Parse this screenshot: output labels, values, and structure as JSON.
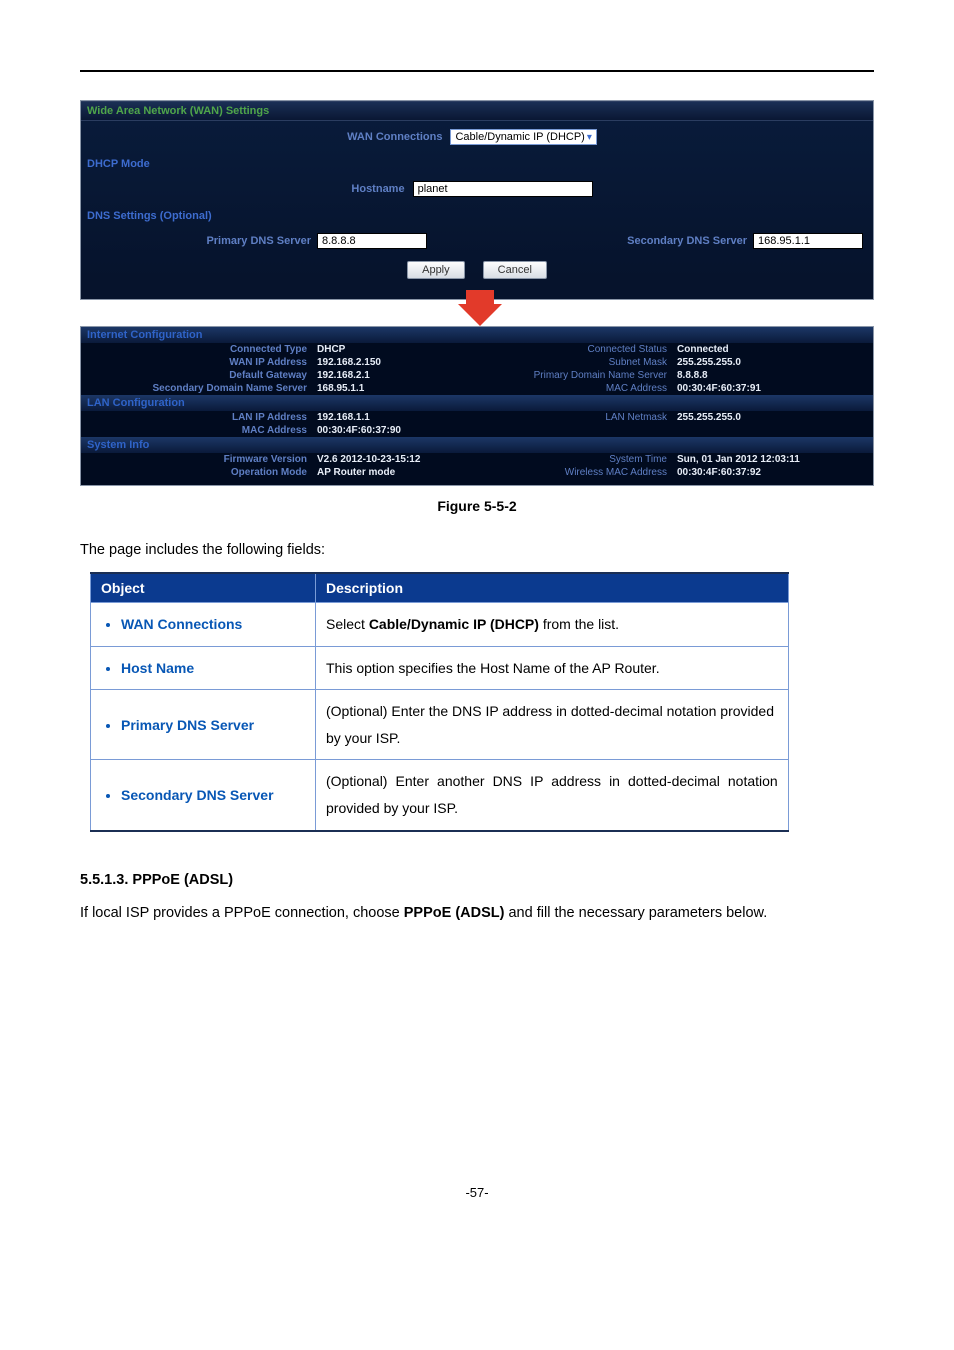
{
  "panel": {
    "wan_title": "Wide Area Network (WAN) Settings",
    "wan_conn_label": "WAN Connections",
    "wan_conn_value": "Cable/Dynamic IP (DHCP)",
    "dhcp_mode": "DHCP Mode",
    "hostname_label": "Hostname",
    "hostname_value": "planet",
    "dns_title": "DNS Settings (Optional)",
    "pdns_label": "Primary DNS Server",
    "pdns_value": "8.8.8.8",
    "sdns_label": "Secondary DNS Server",
    "sdns_value": "168.95.1.1",
    "apply": "Apply",
    "cancel": "Cancel"
  },
  "status": {
    "internet_hdr": "Internet Configuration",
    "rows": {
      "connected_type_l": "Connected Type",
      "connected_type_v": "DHCP",
      "connected_status_l": "Connected Status",
      "connected_status_v": "Connected",
      "wan_ip_l": "WAN IP Address",
      "wan_ip_v": "192.168.2.150",
      "subnet_l": "Subnet Mask",
      "subnet_v": "255.255.255.0",
      "gateway_l": "Default Gateway",
      "gateway_v": "192.168.2.1",
      "pdns_l": "Primary Domain Name Server",
      "pdns_v": "8.8.8.8",
      "sdns_l": "Secondary Domain Name Server",
      "sdns_v": "168.95.1.1",
      "mac_l": "MAC Address",
      "mac_v": "00:30:4F:60:37:91"
    },
    "lan_hdr": "LAN Configuration",
    "lan": {
      "ip_l": "LAN IP Address",
      "ip_v": "192.168.1.1",
      "nm_l": "LAN Netmask",
      "nm_v": "255.255.255.0",
      "mac_l": "MAC Address",
      "mac_v": "00:30:4F:60:37:90"
    },
    "sys_hdr": "System Info",
    "sys": {
      "fw_l": "Firmware Version",
      "fw_v": "V2.6 2012-10-23-15:12",
      "time_l": "System Time",
      "time_v": "Sun, 01 Jan 2012 12:03:11",
      "op_l": "Operation Mode",
      "op_v": "AP Router mode",
      "wmac_l": "Wireless MAC Address",
      "wmac_v": "00:30:4F:60:37:92"
    }
  },
  "figure_caption": "Figure 5-5-2",
  "intro": "The page includes the following fields:",
  "table": {
    "h1": "Object",
    "h2": "Description",
    "r1o": "WAN Connections",
    "r1d_pre": "Select ",
    "r1d_b": "Cable/Dynamic IP (DHCP)",
    "r1d_post": " from the list.",
    "r2o": "Host Name",
    "r2d": "This option specifies the Host Name of the AP Router.",
    "r3o": "Primary DNS Server",
    "r3d": "(Optional) Enter the DNS IP address in dotted-decimal notation provided by your ISP.",
    "r4o": "Secondary DNS Server",
    "r4d": "(Optional) Enter another DNS IP address in dotted-decimal notation provided by your ISP."
  },
  "section": {
    "num": "5.5.1.3.",
    "title": "PPPoE (ADSL)",
    "body_pre": "If local ISP provides a PPPoE connection, choose ",
    "body_b": "PPPoE (ADSL)",
    "body_post": " and fill the necessary parameters below."
  },
  "page_number": "-57-"
}
